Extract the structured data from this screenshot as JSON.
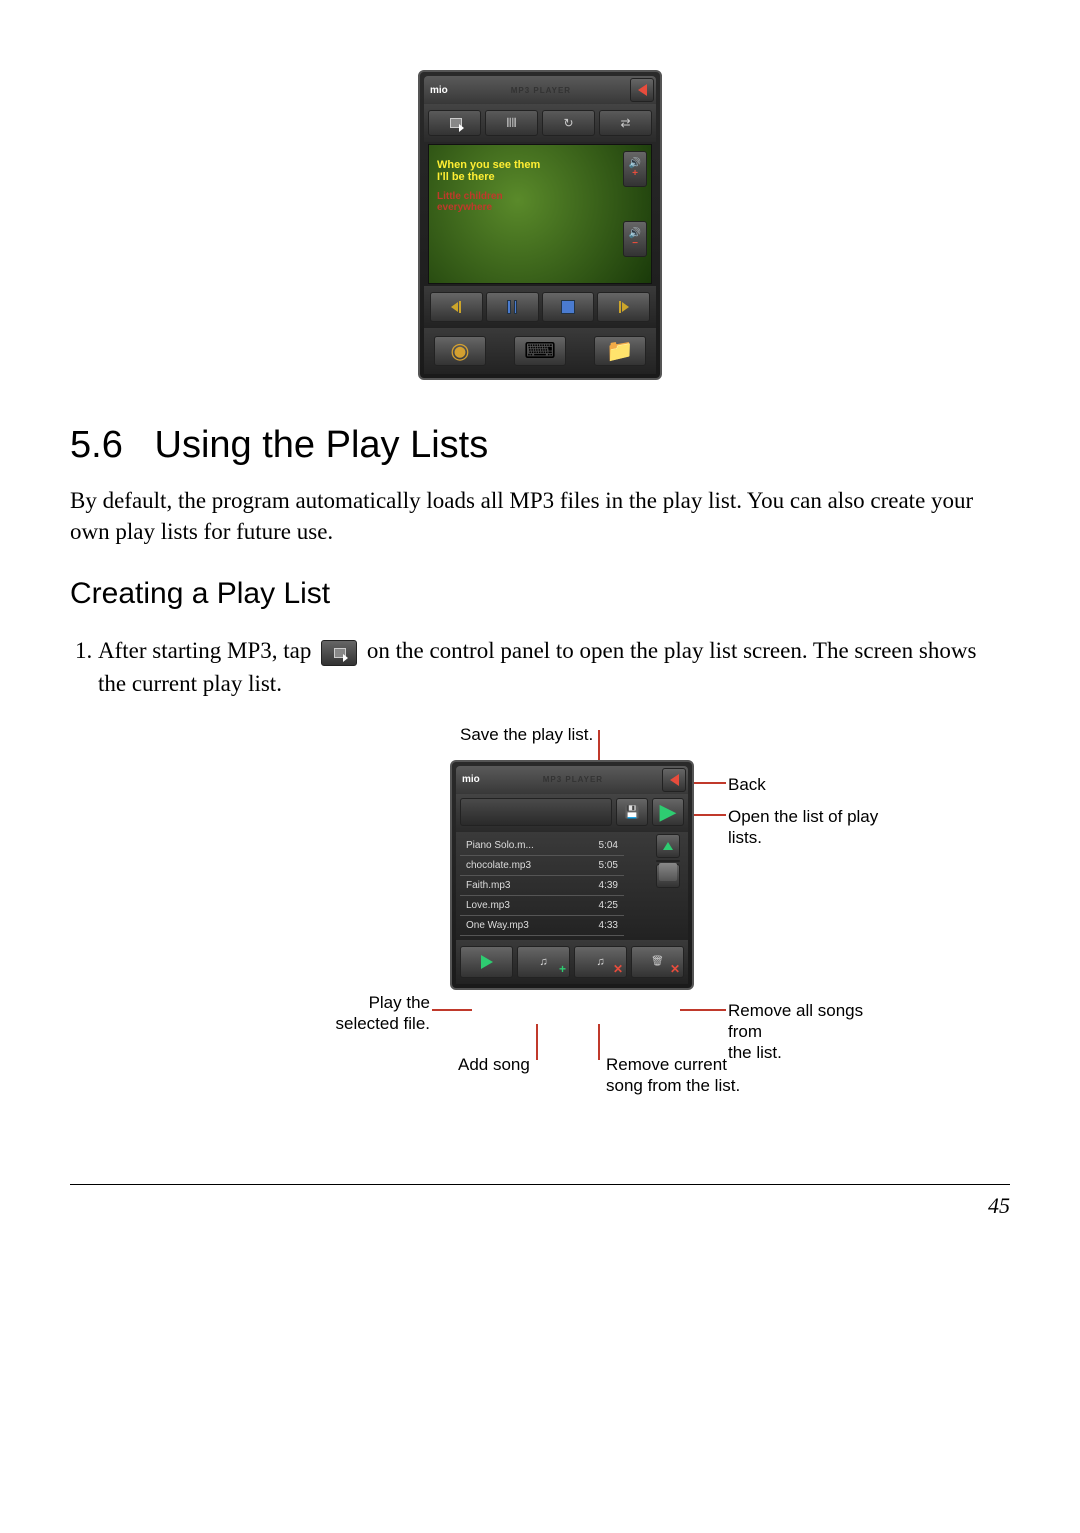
{
  "page_number": "45",
  "section": {
    "number": "5.6",
    "title": "Using the Play Lists"
  },
  "intro": "By default, the program automatically loads all MP3 files in the play list. You can also create your own play lists for future use.",
  "subheading": "Creating a Play List",
  "step1_a": "After starting MP3, tap",
  "step1_b": "on the control panel to open the play list screen. The screen shows the current play list.",
  "player": {
    "brand": "mio",
    "title": "MP3 PLAYER",
    "now_playing": {
      "line1": "When you see them",
      "line2": "I'll be there",
      "line3": "Little children",
      "line4": "everywhere"
    }
  },
  "playlist_screen": {
    "title": "MP3 PLAYER",
    "tracks": [
      {
        "name": "Piano Solo.m...",
        "time": "5:04"
      },
      {
        "name": "chocolate.mp3",
        "time": "5:05"
      },
      {
        "name": "Faith.mp3",
        "time": "4:39"
      },
      {
        "name": "Love.mp3",
        "time": "4:25"
      },
      {
        "name": "One Way.mp3",
        "time": "4:33"
      }
    ]
  },
  "annotations": {
    "save": "Save the play list.",
    "back": "Back",
    "open_list": "Open the list of play lists.",
    "play_sel_1": "Play the",
    "play_sel_2": "selected file.",
    "add": "Add song",
    "remove_cur_1": "Remove current",
    "remove_cur_2": "song from the list.",
    "remove_all_1": "Remove all songs from",
    "remove_all_2": "the list."
  }
}
